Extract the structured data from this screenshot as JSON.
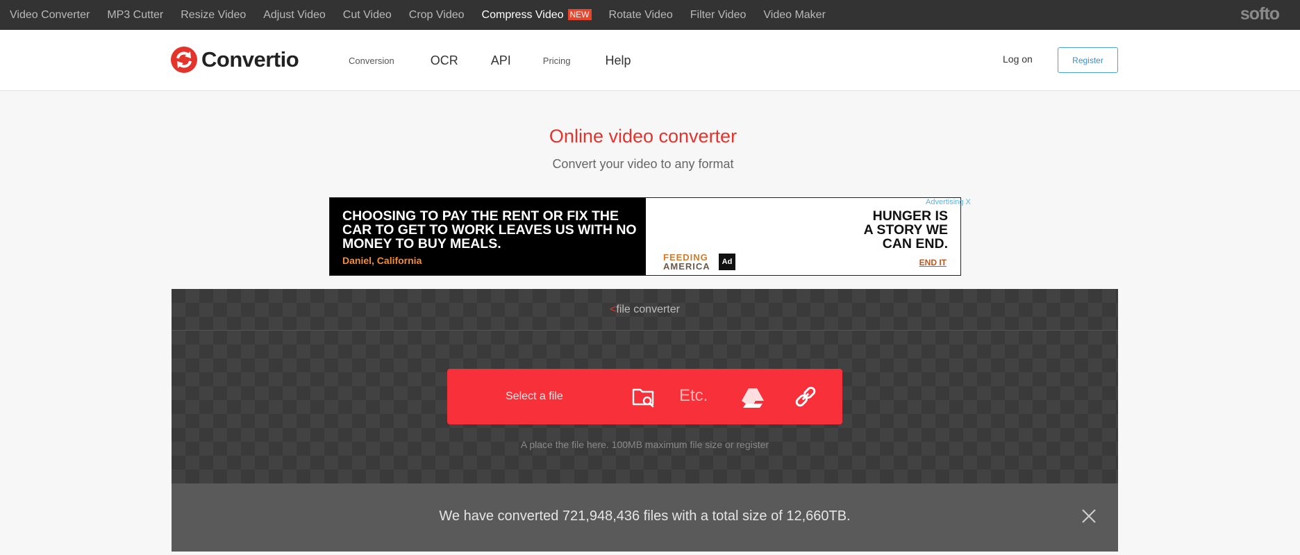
{
  "topbar": {
    "links": [
      {
        "label": "Video Converter"
      },
      {
        "label": "MP3 Cutter"
      },
      {
        "label": "Resize Video"
      },
      {
        "label": "Adjust Video"
      },
      {
        "label": "Cut Video"
      },
      {
        "label": "Crop Video"
      },
      {
        "label": "Compress Video",
        "badge": "NEW"
      },
      {
        "label": "Rotate Video"
      },
      {
        "label": "Filter Video"
      },
      {
        "label": "Video Maker"
      }
    ],
    "brand": "softo"
  },
  "header": {
    "logo_text": "Convertio",
    "nav": [
      {
        "label": "Conversion"
      },
      {
        "label": "OCR"
      },
      {
        "label": "API"
      },
      {
        "label": "Pricing"
      },
      {
        "label": "Help"
      }
    ],
    "login_label": "Log on",
    "register_label": "Register"
  },
  "hero": {
    "title": "Online video converter",
    "subtitle": "Convert your video to any format"
  },
  "ad": {
    "label": "Advertising X",
    "headline_left": "CHOOSING TO PAY THE RENT OR FIX THE CAR TO GET TO WORK LEAVES US WITH NO MONEY TO BUY MEALS.",
    "byline": "Daniel, California",
    "headline_right_1": "HUNGER IS",
    "headline_right_2": "A STORY WE",
    "headline_right_3": "CAN END.",
    "cta": "END IT",
    "brand_line_1": "FEEDING",
    "brand_line_2": "AMERICA",
    "council_badge": "Ad"
  },
  "converter": {
    "title_caret": "<",
    "title": "file converter",
    "select_label": "Select a file",
    "etc_label": "Etc.",
    "hint": "A place the file here. 100MB maximum file size or register",
    "stats": "We have converted 721,948,436 files with a total size of 12,660TB.",
    "accent_color": "#f7303a"
  }
}
